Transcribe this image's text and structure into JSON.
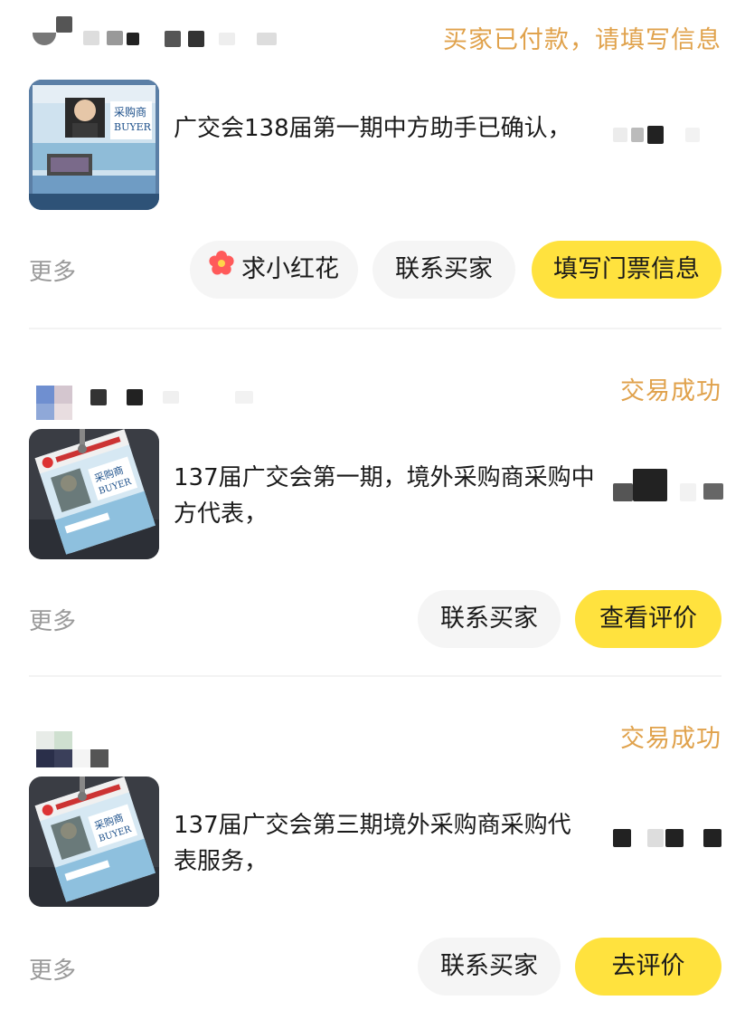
{
  "colors": {
    "status": "#e0a24c",
    "primary_button": "#ffe23e",
    "secondary_button": "#f5f5f5",
    "more_text": "#9a9a9a"
  },
  "orders": [
    {
      "status": "买家已付款，请填写信息",
      "title": "广交会138届第一期中方助手已确认，",
      "more": "更多",
      "buttons": [
        {
          "label": "求小红花",
          "icon": "red-flower-icon"
        },
        {
          "label": "联系买家"
        },
        {
          "label": "填写门票信息"
        }
      ]
    },
    {
      "status": "交易成功",
      "title": "137届广交会第一期，境外采购商采购中方代表，",
      "more": "更多",
      "buttons": [
        {
          "label": "联系买家"
        },
        {
          "label": "查看评价"
        }
      ]
    },
    {
      "status": "交易成功",
      "title": "137届广交会第三期境外采购商采购代表服务，",
      "more": "更多",
      "buttons": [
        {
          "label": "联系买家"
        },
        {
          "label": "去评价"
        }
      ]
    }
  ]
}
